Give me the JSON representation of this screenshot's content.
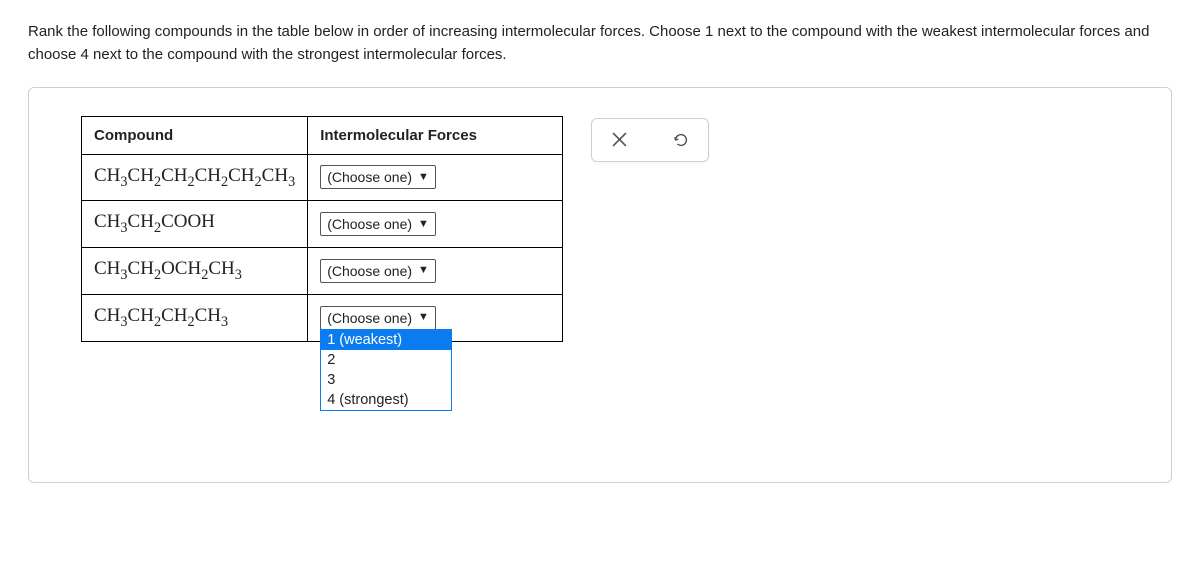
{
  "question": "Rank the following compounds in the table below in order of increasing intermolecular forces. Choose 1 next to the compound with the weakest intermolecular forces and choose 4 next to the compound with the strongest intermolecular forces.",
  "table": {
    "header_compound": "Compound",
    "header_forces": "Intermolecular Forces",
    "choose_label": "(Choose one)",
    "rows": [
      {
        "formula_html": "CH<sub>3</sub>CH<sub>2</sub>CH<sub>2</sub>CH<sub>2</sub>CH<sub>2</sub>CH<sub>3</sub>"
      },
      {
        "formula_html": "CH<sub>3</sub>CH<sub>2</sub>COOH"
      },
      {
        "formula_html": "CH<sub>3</sub>CH<sub>2</sub>OCH<sub>2</sub>CH<sub>3</sub>"
      },
      {
        "formula_html": "CH<sub>3</sub>CH<sub>2</sub>CH<sub>2</sub>CH<sub>3</sub>"
      }
    ]
  },
  "dropdown": {
    "options": [
      "1 (weakest)",
      "2",
      "3",
      "4 (strongest)"
    ],
    "selected_index": 0
  }
}
